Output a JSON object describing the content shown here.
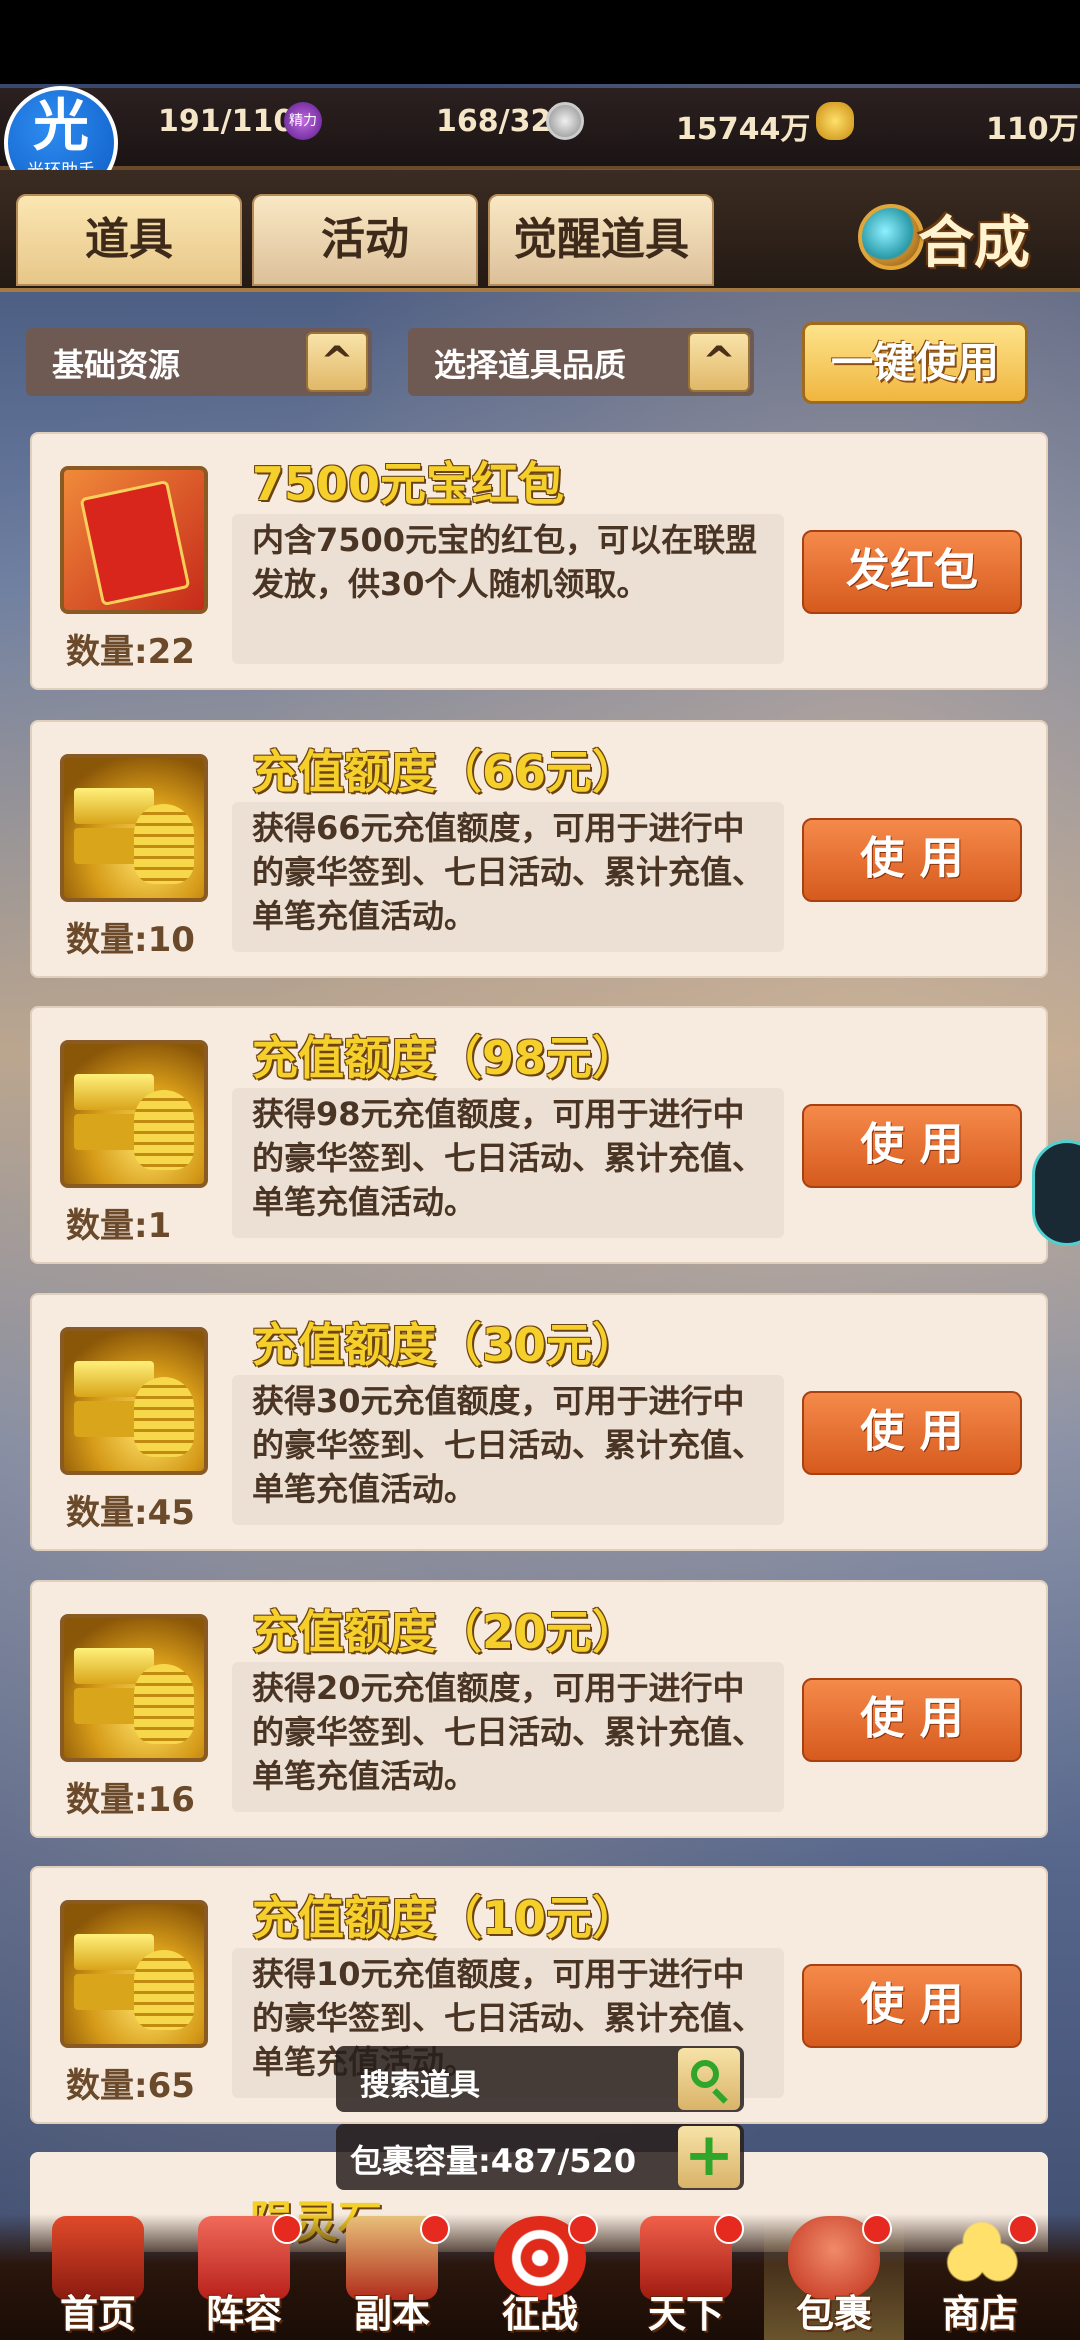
{
  "resources": [
    {
      "value": "191/110",
      "icon": null
    },
    {
      "value": "168/32",
      "icon": "energy-icon",
      "icon_text": "精力"
    },
    {
      "value": "15744万",
      "icon": "silver-coin-icon"
    },
    {
      "value": "110万",
      "icon": "gold-ingot-icon"
    }
  ],
  "assistant": {
    "big": "光",
    "small": "光环助手"
  },
  "tabs": [
    {
      "label": "道具",
      "active": true
    },
    {
      "label": "活动",
      "active": false
    },
    {
      "label": "觉醒道具",
      "active": false
    }
  ],
  "synth_label": "合成",
  "filters": {
    "resource": "基础资源",
    "quality": "选择道具品质",
    "arrow": "^",
    "one_key": "一键使用"
  },
  "items": [
    {
      "title": "7500元宝红包",
      "icon": "red-envelope-icon",
      "desc": "内含7500元宝的红包，可以在联盟发放，供30个人随机领取。",
      "qty": "数量:22",
      "action": "发红包"
    },
    {
      "title": "充值额度（66元）",
      "icon": "gold-bars-icon",
      "desc": "获得66元充值额度，可用于进行中的豪华签到、七日活动、累计充值、单笔充值活动。",
      "qty": "数量:10",
      "action": "使 用"
    },
    {
      "title": "充值额度（98元）",
      "icon": "gold-bars-icon",
      "desc": "获得98元充值额度，可用于进行中的豪华签到、七日活动、累计充值、单笔充值活动。",
      "qty": "数量:1",
      "action": "使 用"
    },
    {
      "title": "充值额度（30元）",
      "icon": "gold-bars-icon",
      "desc": "获得30元充值额度，可用于进行中的豪华签到、七日活动、累计充值、单笔充值活动。",
      "qty": "数量:45",
      "action": "使 用"
    },
    {
      "title": "充值额度（20元）",
      "icon": "gold-bars-icon",
      "desc": "获得20元充值额度，可用于进行中的豪华签到、七日活动、累计充值、单笔充值活动。",
      "qty": "数量:16",
      "action": "使 用"
    },
    {
      "title": "充值额度（10元）",
      "icon": "gold-bars-icon",
      "desc": "获得10元充值额度，可用于进行中的豪华签到、七日活动、累计充值、单笔充值活动。",
      "qty": "数量:65",
      "action": "使 用"
    }
  ],
  "partial_item_title": "陨灵石",
  "search": {
    "label": "搜索道具"
  },
  "capacity": {
    "label": "包裹容量:487/520",
    "plus": "+"
  },
  "nav": [
    {
      "label": "首页",
      "icon": "home-icon",
      "dot": false,
      "active": false
    },
    {
      "label": "阵容",
      "icon": "lineup-icon",
      "dot": true,
      "active": false
    },
    {
      "label": "副本",
      "icon": "dungeon-icon",
      "dot": true,
      "active": false
    },
    {
      "label": "征战",
      "icon": "battle-target-icon",
      "dot": true,
      "active": false
    },
    {
      "label": "天下",
      "icon": "world-icon",
      "dot": true,
      "active": false
    },
    {
      "label": "包裹",
      "icon": "bag-icon",
      "dot": true,
      "active": true
    },
    {
      "label": "商店",
      "icon": "shop-coins-icon",
      "dot": true,
      "active": false
    }
  ],
  "colors": {
    "accent": "#f0b640",
    "action": "#e06a2e",
    "title_gold": "#f5cf2a",
    "card_bg": "#f7ebe0"
  }
}
